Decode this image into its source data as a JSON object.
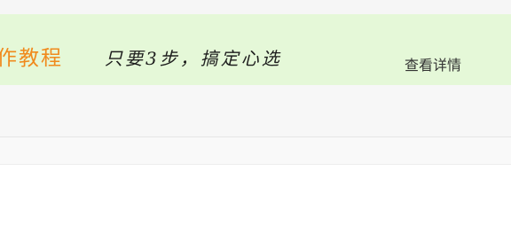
{
  "banner": {
    "title": "作教程",
    "slogan": "只要3步，搞定心选",
    "details_link": "查看详情",
    "title_color": "#f08a1d",
    "background_color": "#e5f8d8"
  }
}
